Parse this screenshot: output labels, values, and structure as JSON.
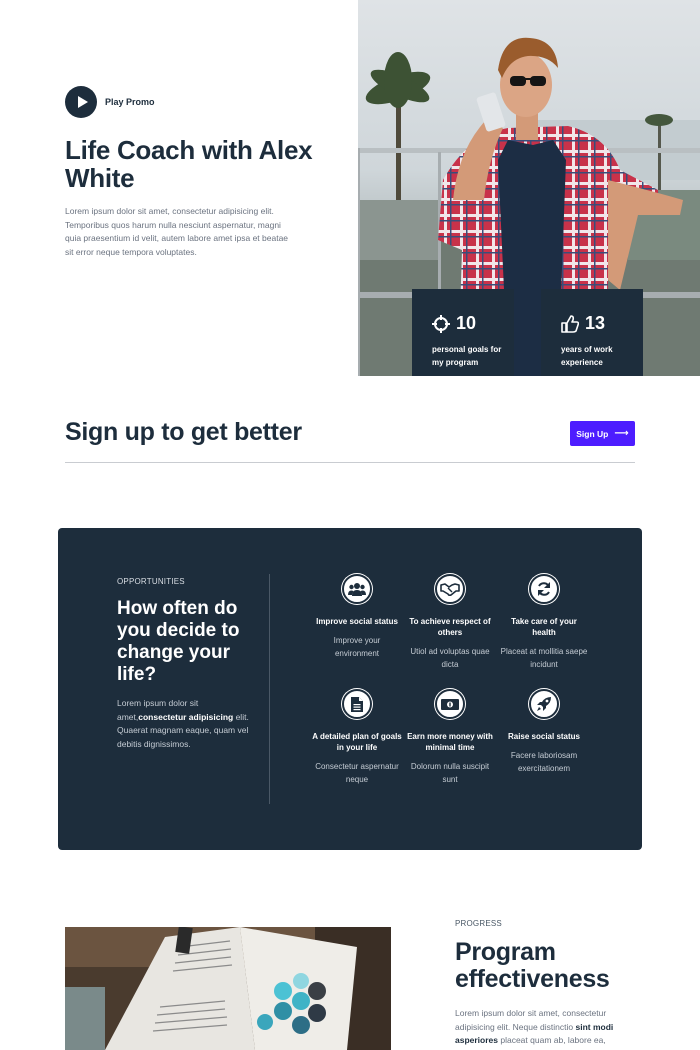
{
  "hero": {
    "play_label": "Play Promo",
    "title": "Life Coach with Alex White",
    "body": "Lorem ipsum dolor sit amet, consectetur adipisicing elit. Temporibus quos harum nulla nesciunt aspernatur, magni quia praesentium id velit, autem labore amet ipsa et beatae sit error neque tempora voluptates.",
    "stats": [
      {
        "icon": "crosshair-icon",
        "number": "10",
        "label": "personal goals for my program"
      },
      {
        "icon": "thumbs-up-icon",
        "number": "13",
        "label": "years of work experience"
      }
    ]
  },
  "signup": {
    "title": "Sign up to get better",
    "button_label": "Sign Up",
    "button_icon": "arrow-right-icon",
    "accent_color": "#4d1dff"
  },
  "opportunities": {
    "eyebrow": "OPPORTUNITIES",
    "title": "How often do you decide to change your life?",
    "body_pre": "Lorem ipsum dolor sit amet,",
    "body_bold": "consectetur adipisicing",
    "body_post": " elit. Quaerat magnam eaque, quam vel debitis dignissimos.",
    "panel_color": "#1d2d3c",
    "features": [
      {
        "icon": "users-icon",
        "title": "Improve social status",
        "desc": "Improve your environment"
      },
      {
        "icon": "handshake-icon",
        "title": "To achieve respect of others",
        "desc": "Utiol ad voluptas quae dicta"
      },
      {
        "icon": "sync-icon",
        "title": "Take care of your health",
        "desc": "Placeat at mollitia saepe incidunt"
      },
      {
        "icon": "document-icon",
        "title": "A detailed plan of goals in your life",
        "desc": "Consectetur aspernatur neque"
      },
      {
        "icon": "money-bill-icon",
        "title": "Earn more money with minimal time",
        "desc": "Dolorum nulla suscipit sunt"
      },
      {
        "icon": "rocket-icon",
        "title": "Raise social status",
        "desc": "Facere laboriosam exercitationem"
      }
    ]
  },
  "progress": {
    "eyebrow": "PROGRESS",
    "title": "Program effectiveness",
    "body_pre": "Lorem ipsum dolor sit amet, consectetur adipisicing elit. Neque distinctio ",
    "body_bold": "sint modi asperiores",
    "body_post": " placeat quam ab, labore ea,"
  }
}
